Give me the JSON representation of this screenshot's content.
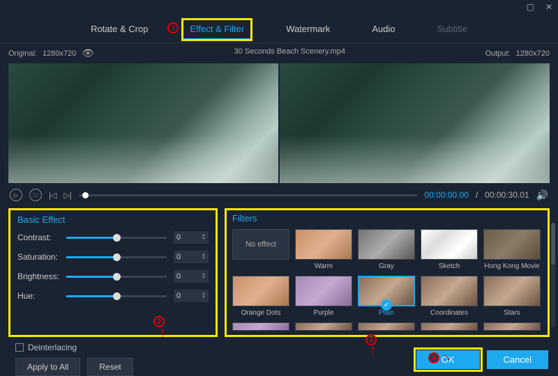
{
  "window": {
    "minimize": "▢",
    "close": "✕"
  },
  "tabs": {
    "rotate": "Rotate & Crop",
    "effect": "Effect & Filter",
    "watermark": "Watermark",
    "audio": "Audio",
    "subtitle": "Subtitle"
  },
  "info": {
    "original_label": "Original:",
    "original_res": "1280x720",
    "filename": "30 Seconds Beach Scenery.mp4",
    "output_label": "Output:",
    "output_res": "1280x720"
  },
  "playback": {
    "current": "00:00:00.00",
    "sep": "/",
    "total": "00:00:30.01"
  },
  "basic_effect": {
    "title": "Basic Effect",
    "rows": [
      {
        "label": "Contrast:",
        "value": "0",
        "pct": 50
      },
      {
        "label": "Saturation:",
        "value": "0",
        "pct": 50
      },
      {
        "label": "Brightness:",
        "value": "0",
        "pct": 50
      },
      {
        "label": "Hue:",
        "value": "0",
        "pct": 50
      }
    ]
  },
  "filters": {
    "title": "Filters",
    "noeffect": "No effect",
    "items": [
      "Warm",
      "Gray",
      "Sketch",
      "Hong Kong Movie",
      "Orange Dots",
      "Purple",
      "Plain",
      "Coordinates",
      "Stars"
    ],
    "selected": "Plain"
  },
  "deinterlacing": "Deinterlacing",
  "buttons": {
    "apply_all": "Apply to All",
    "reset": "Reset",
    "ok": "OK",
    "cancel": "Cancel"
  },
  "annotations": {
    "a1": "1",
    "a2": "2",
    "a3": "3",
    "a4": "4"
  }
}
